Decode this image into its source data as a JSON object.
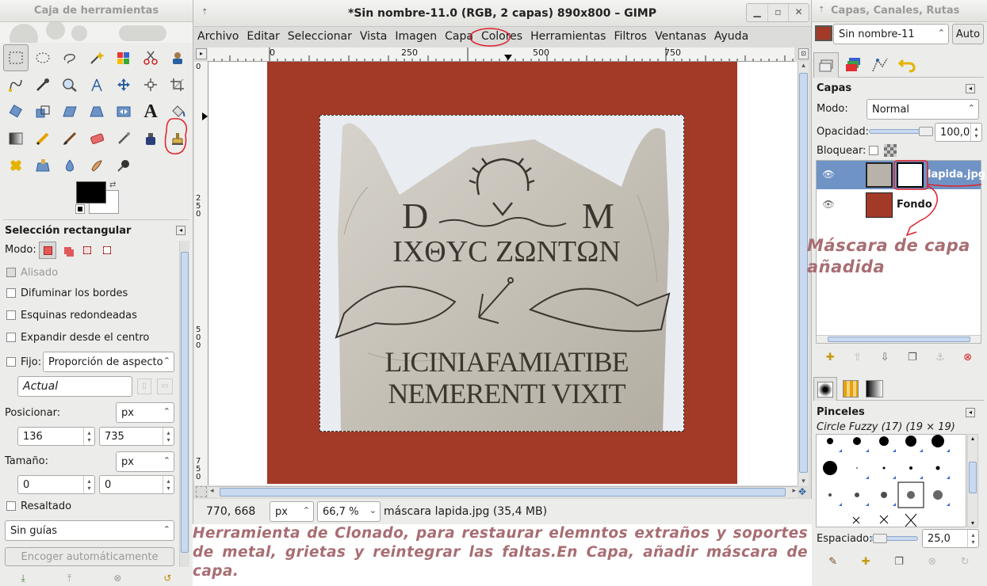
{
  "toolbox": {
    "title": "Caja de herramientas",
    "options_title": "Selección rectangular",
    "mode_label": "Modo:",
    "antialias": "Alisado",
    "feather": "Difuminar los bordes",
    "rounded": "Esquinas redondeadas",
    "expand_center": "Expandir desde el centro",
    "fixed_label": "Fijo:",
    "fixed_value": "Proporción de aspecto",
    "current": "Actual",
    "position_label": "Posicionar:",
    "unit1": "px",
    "pos_x": "136",
    "pos_y": "735",
    "size_label": "Tamaño:",
    "unit2": "px",
    "size_w": "0",
    "size_h": "0",
    "highlight": "Resaltado",
    "guides": "Sin guías",
    "auto_shrink": "Encoger automáticamente"
  },
  "image_window": {
    "title": "*Sin nombre-11.0 (RGB, 2 capas) 890x800 – GIMP",
    "menu": [
      "Archivo",
      "Editar",
      "Seleccionar",
      "Vista",
      "Imagen",
      "Capa",
      "Colores",
      "Herramientas",
      "Filtros",
      "Ventanas",
      "Ayuda"
    ],
    "ruler_marks": [
      "0",
      "250",
      "500",
      "750"
    ],
    "vruler_marks": [
      "0",
      "250",
      "500",
      "750"
    ],
    "coords": "770, 668",
    "unit": "px",
    "zoom": "66,7 %",
    "status": "máscara lapida.jpg (35,4 MB)",
    "inscription": [
      "D",
      "M",
      "IXΘYC ZΩNTΩN",
      "LICINIAFAMIATIBE",
      "NEMERENTI VIXIT"
    ]
  },
  "layers_dock": {
    "title": "Capas, Canales, Rutas",
    "image_select": "Sin nombre-11",
    "auto": "Auto",
    "layers_heading": "Capas",
    "mode_label": "Modo:",
    "mode_value": "Normal",
    "opacity_label": "Opacidad:",
    "opacity_value": "100,0",
    "opacity": 1.0,
    "lock_label": "Bloquear:",
    "layers": [
      {
        "name": "lapida.jpg",
        "selected": true
      },
      {
        "name": "Fondo",
        "selected": false
      }
    ],
    "brushes_heading": "Pinceles",
    "brush_name": "Circle Fuzzy (17) (19 × 19)",
    "spacing_label": "Espaciado:",
    "spacing_value": "25,0"
  },
  "annotations": {
    "mask_note": "Máscara de capa añadida",
    "clone_note": "Herramienta de Clonado, para restaurar elemntos extraños y soportes de metal, grietas y reintegrar las faltas.En Capa, añadir máscara de capa."
  },
  "colors": {
    "canvas_bg": "#a23a27",
    "annotation": "#a86d72",
    "selection": "#6f93c4",
    "red_mark": "#e0202a"
  }
}
